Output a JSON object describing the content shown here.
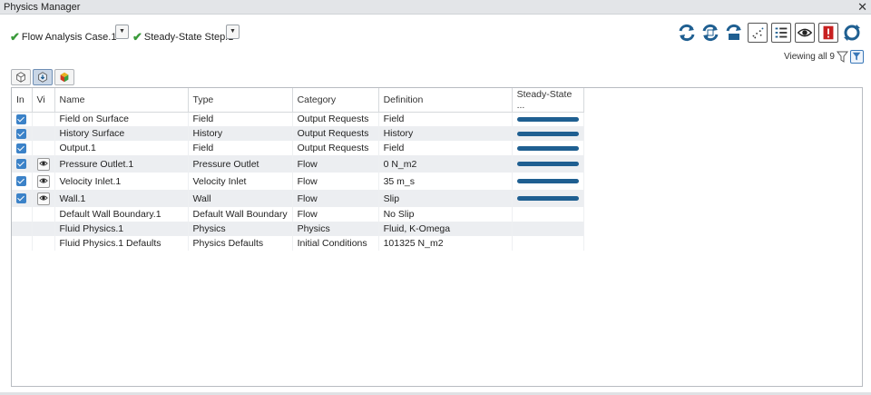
{
  "window": {
    "title": "Physics Manager",
    "close_label": "✕"
  },
  "cases": {
    "analysis_case": "Flow Analysis Case.1",
    "step": "Steady-State Step.1",
    "check_glyph": "✔",
    "dropdown_glyph": "▼"
  },
  "toolbar": {
    "icons": [
      "refresh-icon",
      "refresh-all-icon",
      "update-icon",
      "plot-grid-icon",
      "checklist-icon",
      "visibility-icon",
      "warning-icon",
      "sync-icon"
    ]
  },
  "filter": {
    "viewing_label": "Viewing all 9"
  },
  "colors": {
    "accent": "#3b82c8",
    "bar": "#1f5f91",
    "check_green": "#3a9a3a",
    "warning_red": "#c82020"
  },
  "table": {
    "headers": [
      "In",
      "Vi",
      "Name",
      "Type",
      "Category",
      "Definition",
      "Steady-State ..."
    ],
    "rows": [
      {
        "in": true,
        "vi": false,
        "name": "Field on Surface",
        "type": "Field",
        "category": "Output Requests",
        "definition": "Field",
        "active": true
      },
      {
        "in": true,
        "vi": false,
        "name": "History Surface",
        "type": "History",
        "category": "Output Requests",
        "definition": "History",
        "active": true
      },
      {
        "in": true,
        "vi": false,
        "name": "Output.1",
        "type": "Field",
        "category": "Output Requests",
        "definition": "Field",
        "active": true
      },
      {
        "in": true,
        "vi": true,
        "name": "Pressure Outlet.1",
        "type": "Pressure Outlet",
        "category": "Flow",
        "definition": "0 N_m2",
        "active": true
      },
      {
        "in": true,
        "vi": true,
        "name": "Velocity Inlet.1",
        "type": "Velocity Inlet",
        "category": "Flow",
        "definition": "35 m_s",
        "active": true
      },
      {
        "in": true,
        "vi": true,
        "name": "Wall.1",
        "type": "Wall",
        "category": "Flow",
        "definition": "Slip",
        "active": true
      },
      {
        "in": false,
        "vi": false,
        "name": "Default Wall Boundary.1",
        "type": "Default Wall Boundary",
        "category": "Flow",
        "definition": "No Slip",
        "active": false
      },
      {
        "in": false,
        "vi": false,
        "name": "Fluid Physics.1",
        "type": "Physics",
        "category": "Physics",
        "definition": "Fluid, K-Omega",
        "active": false
      },
      {
        "in": false,
        "vi": false,
        "name": "Fluid Physics.1 Defaults",
        "type": "Physics Defaults",
        "category": "Initial Conditions",
        "definition": "101325 N_m2",
        "active": false
      }
    ]
  }
}
